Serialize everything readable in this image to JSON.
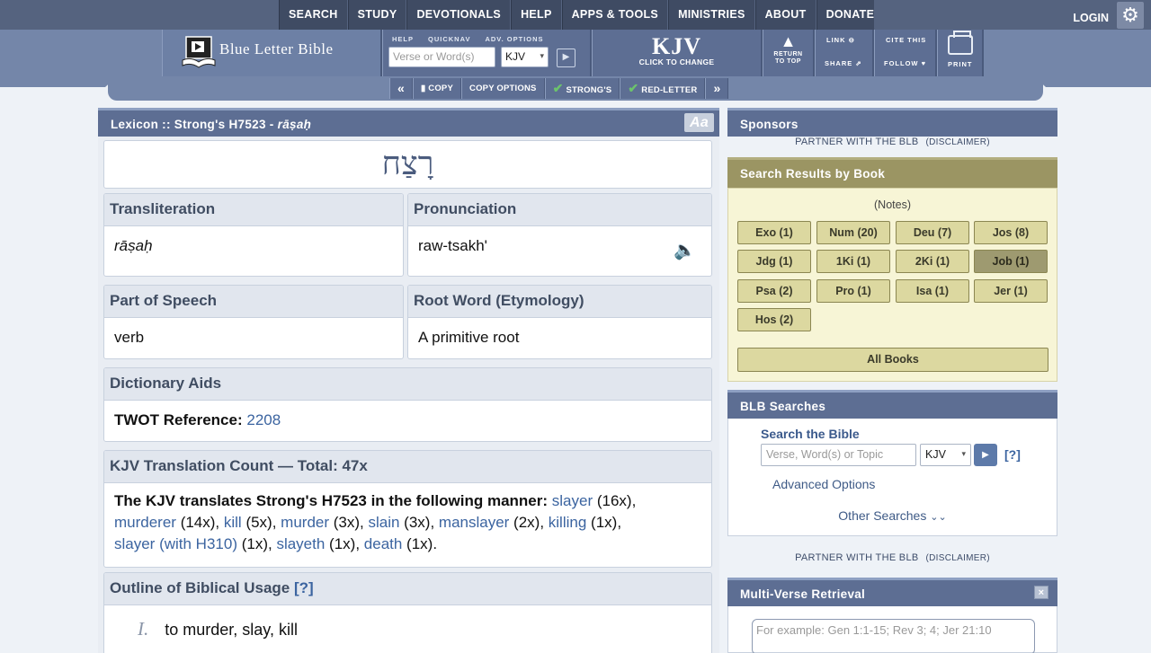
{
  "nav": {
    "items": [
      "SEARCH",
      "STUDY",
      "DEVOTIONALS",
      "HELP",
      "APPS & TOOLS",
      "MINISTRIES",
      "ABOUT",
      "DONATE"
    ],
    "login": "LOGIN",
    "settings_icon": "gear-icon"
  },
  "toolbar": {
    "logo_text": "Blue Letter Bible",
    "labels": {
      "help": "HELP",
      "quicknav": "QUICKNAV",
      "adv_options": "ADV. OPTIONS"
    },
    "verse_placeholder": "Verse or Word(s)",
    "version": "KJV",
    "kjv_big": "KJV",
    "kjv_small": "CLICK TO CHANGE",
    "return_to_top": [
      "RETURN",
      "TO TOP"
    ],
    "link_this": "LINK",
    "share": "SHARE",
    "cite_this": "CITE THIS",
    "follow": "FOLLOW",
    "print": "PRINT"
  },
  "subbar": {
    "copy": "COPY",
    "copy_options": "COPY OPTIONS",
    "strongs": "STRONG'S",
    "red_letter": "RED-LETTER"
  },
  "lexicon": {
    "header_prefix": "Lexicon :: Strong's H7523 - ",
    "header_translit": "rāṣaḥ",
    "font_button": "Aa",
    "hebrew": "רָצַח",
    "transliteration_label": "Transliteration",
    "transliteration": "rāṣaḥ",
    "pronunciation_label": "Pronunciation",
    "pronunciation": "raw-tsakh'",
    "pos_label": "Part of Speech",
    "pos": "verb",
    "root_label": "Root Word (Etymology)",
    "root": "A primitive root",
    "dict_label": "Dictionary Aids",
    "twot_label": "TWOT Reference:",
    "twot_value": "2208",
    "count_label": "KJV Translation Count — Total: 47x",
    "count_intro": "The KJV translates Strong's H7523 in the following manner:",
    "translations": [
      {
        "word": "slayer",
        "count": " (16x), "
      },
      {
        "word": "murderer",
        "count": " (14x), "
      },
      {
        "word": "kill",
        "count": " (5x), "
      },
      {
        "word": "murder",
        "count": " (3x), "
      },
      {
        "word": "slain",
        "count": " (3x), "
      },
      {
        "word": "manslayer",
        "count": " (2x), "
      },
      {
        "word": "killing",
        "count": " (1x), "
      },
      {
        "word": "slayer (with H310)",
        "count": " (1x), "
      },
      {
        "word": "slayeth",
        "count": " (1x), "
      },
      {
        "word": "death",
        "count": " (1x)."
      }
    ],
    "outline_label": "Outline of Biblical Usage",
    "outline_help": "[?]",
    "outline_items": [
      {
        "num": "I.",
        "text": "to murder, slay, kill"
      }
    ]
  },
  "sponsors": {
    "title": "Sponsors",
    "partner": "PARTNER WITH THE BLB",
    "disclaimer": "(DISCLAIMER)"
  },
  "search_results": {
    "title": "Search Results by Book",
    "notes": "(Notes)",
    "books": [
      "Exo (1)",
      "Num (20)",
      "Deu (7)",
      "Jos (8)",
      "Jdg (1)",
      "1Ki (1)",
      "2Ki (1)",
      "Job (1)",
      "Psa (2)",
      "Pro (1)",
      "Isa (1)",
      "Jer (1)",
      "Hos (2)"
    ],
    "selected": "Job (1)",
    "all_books": "All Books"
  },
  "blb_searches": {
    "title": "BLB Searches",
    "search_title": "Search the Bible",
    "placeholder": "Verse, Word(s) or Topic",
    "version": "KJV",
    "help": "[?]",
    "advanced": "Advanced Options",
    "other": "Other Searches"
  },
  "multi_verse": {
    "title": "Multi-Verse Retrieval",
    "placeholder": "For example: Gen 1:1-15; Rev 3; 4; Jer 21:10"
  }
}
